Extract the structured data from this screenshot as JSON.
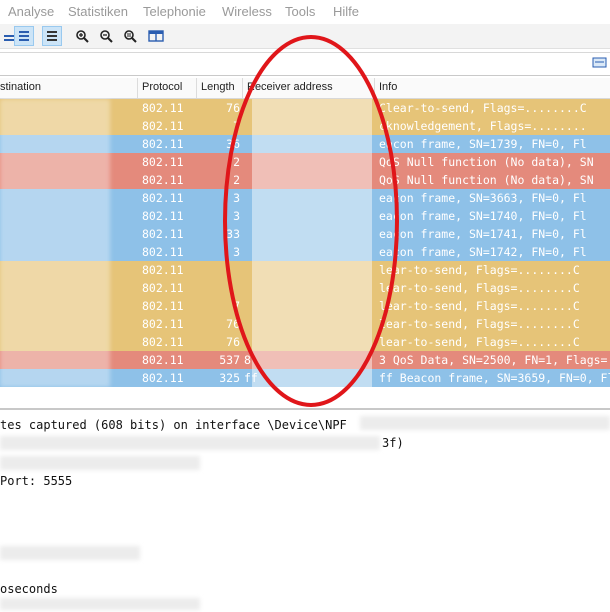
{
  "menu": [
    "Analyse",
    "Statistiken",
    "Telephonie",
    "Wireless",
    "Tools",
    "Hilfe"
  ],
  "toolbar_icons": [
    "autoscroll-icon",
    "colorize-icon",
    "zoom-in-icon",
    "zoom-out-icon",
    "zoom-normal-icon",
    "resize-columns-icon"
  ],
  "columns": {
    "destination": "stination",
    "protocol": "Protocol",
    "length": "Length",
    "receiver": "Receiver address",
    "info": "Info"
  },
  "colors": {
    "yellow": "#e6c478",
    "blue": "#8ec1e8",
    "red": "#e48a7c",
    "annotation": "#e0161a"
  },
  "packets": [
    {
      "protocol": "802.11",
      "length": "76",
      "receiver": "",
      "info": "Clear-to-send, Flags=........C",
      "color": "yellow"
    },
    {
      "protocol": "802.11",
      "length": "7",
      "receiver": "",
      "info": "cknowledgement, Flags=........",
      "color": "yellow"
    },
    {
      "protocol": "802.11",
      "length": "36",
      "receiver": "",
      "info": "eacon frame, SN=1739, FN=0, Fl",
      "color": "blue"
    },
    {
      "protocol": "802.11",
      "length": "2",
      "receiver": "",
      "info": "QoS Null function (No data), SN",
      "color": "red"
    },
    {
      "protocol": "802.11",
      "length": "2",
      "receiver": "",
      "info": "QoS Null function (No data), SN",
      "color": "red"
    },
    {
      "protocol": "802.11",
      "length": "3",
      "receiver": "",
      "info": "eacon frame, SN=3663, FN=0, Fl",
      "color": "blue"
    },
    {
      "protocol": "802.11",
      "length": "3",
      "receiver": "",
      "info": "eacon frame, SN=1740, FN=0, Fl",
      "color": "blue"
    },
    {
      "protocol": "802.11",
      "length": "33",
      "receiver": "",
      "info": "eacon frame, SN=1741, FN=0, Fl",
      "color": "blue"
    },
    {
      "protocol": "802.11",
      "length": "3",
      "receiver": "",
      "info": "eacon frame, SN=1742, FN=0, Fl",
      "color": "blue"
    },
    {
      "protocol": "802.11",
      "length": "",
      "receiver": "",
      "info": "lear-to-send, Flags=........C",
      "color": "yellow"
    },
    {
      "protocol": "802.11",
      "length": "",
      "receiver": "",
      "info": "lear-to-send, Flags=........C",
      "color": "yellow"
    },
    {
      "protocol": "802.11",
      "length": "7",
      "receiver": "",
      "info": "lear-to-send, Flags=........C",
      "color": "yellow"
    },
    {
      "protocol": "802.11",
      "length": "76",
      "receiver": "",
      "info": "lear-to-send, Flags=........C",
      "color": "yellow"
    },
    {
      "protocol": "802.11",
      "length": "76",
      "receiver": "",
      "info": "lear-to-send, Flags=........C",
      "color": "yellow"
    },
    {
      "protocol": "802.11",
      "length": "537",
      "receiver": "8",
      "info": "3 QoS Data, SN=2500, FN=1, Flags=",
      "color": "red"
    },
    {
      "protocol": "802.11",
      "length": "325",
      "receiver": "ff",
      "info": "ff Beacon frame, SN=3659, FN=0, Fl",
      "color": "blue"
    }
  ],
  "details": {
    "line1": "tes captured (608 bits) on interface \\Device\\NPF",
    "line1_tail": "3f)",
    "line2": " Port: 5555",
    "line3": "oseconds"
  }
}
